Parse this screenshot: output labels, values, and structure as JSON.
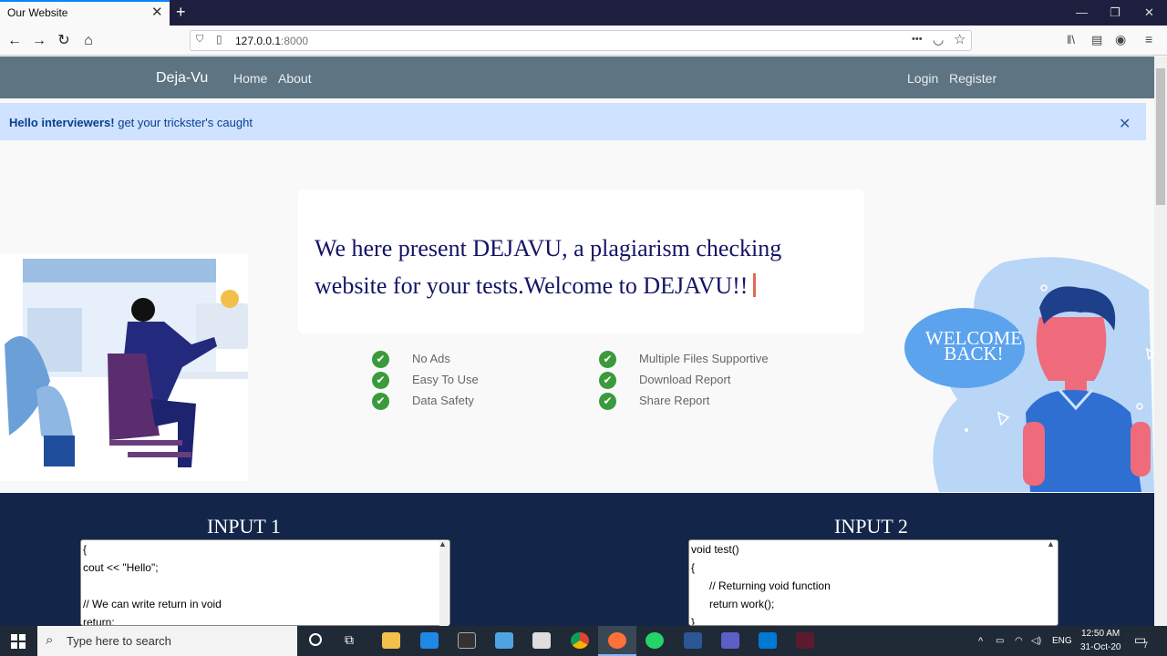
{
  "browser": {
    "tab_title": "Our Website",
    "tab_close": "✕",
    "new_tab": "+",
    "url_host": "127.0.0.1",
    "url_port": ":8000",
    "menu_dots": "•••"
  },
  "site": {
    "brand": "Deja-Vu",
    "nav": [
      "Home",
      "About"
    ],
    "auth": [
      "Login",
      "Register"
    ],
    "alert_bold": "Hello interviewers!",
    "alert_text": " get your trickster's caught",
    "alert_close": "✕",
    "headline": "We here present DEJAVU, a plagiarism checking website for your tests.Welcome to DEJAVU!!",
    "features_left": [
      "No Ads",
      "Easy To Use",
      "Data Safety"
    ],
    "features_right": [
      "Multiple Files Supportive",
      "Download Report",
      "Share Report"
    ],
    "bubble": "WELCOME BACK!",
    "input1_label": "INPUT 1",
    "input2_label": "INPUT 2",
    "input1_code": "{\ncout << \"Hello\";\n\n// We can write return in void\nreturn;",
    "input2_code": "void test()\n{\n      // Returning void function\n      return work();\n}"
  },
  "taskbar": {
    "search_placeholder": "Type here to search",
    "lang": "ENG",
    "time": "12:50 AM",
    "date": "31-Oct-20",
    "notifications": "7"
  },
  "colors": {
    "nav_bg": "#5e7482",
    "alert_bg": "#cfe2ff",
    "headline": "#141466",
    "check": "#3a9a3c",
    "dark_section": "#13264a"
  }
}
